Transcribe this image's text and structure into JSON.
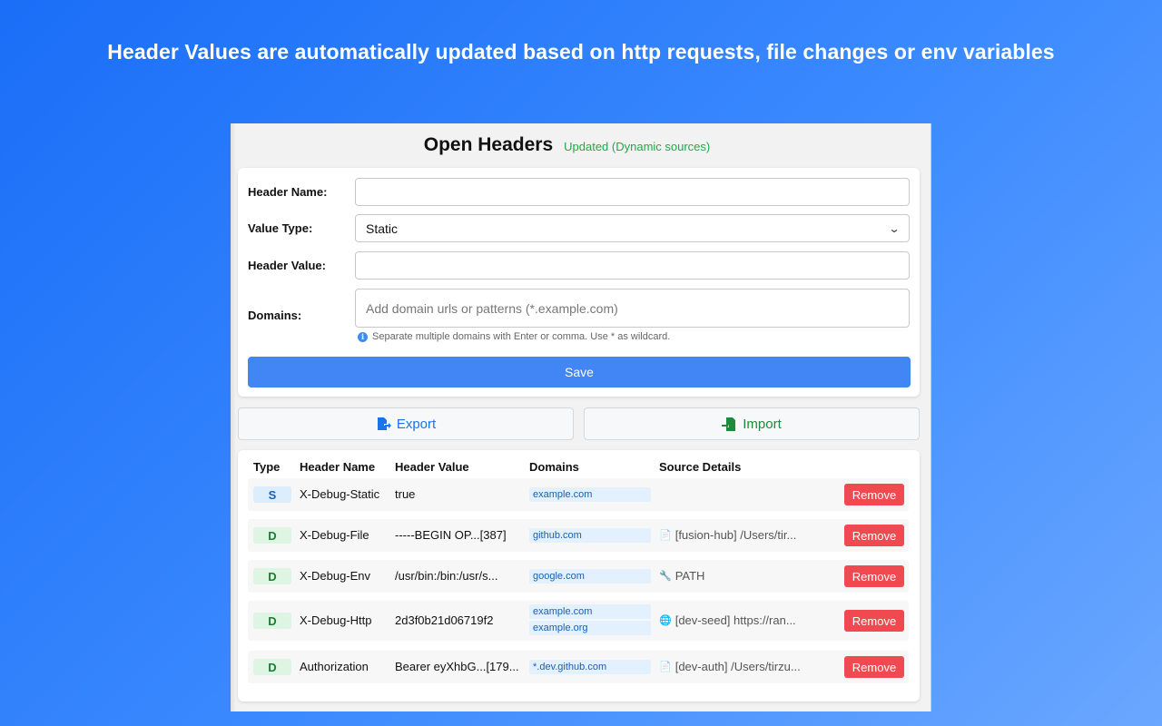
{
  "banner": {
    "text": "Header Values are automatically updated based on http requests, file changes or env variables"
  },
  "app": {
    "title": "Open Headers",
    "status": "Updated (Dynamic sources)"
  },
  "form": {
    "header_name_label": "Header Name:",
    "header_name_value": "",
    "value_type_label": "Value Type:",
    "value_type_selected": "Static",
    "header_value_label": "Header Value:",
    "header_value_value": "",
    "domains_label": "Domains:",
    "domains_placeholder": "Add domain urls or patterns (*.example.com)",
    "domains_hint": "Separate multiple domains with Enter or comma. Use * as wildcard.",
    "save_label": "Save"
  },
  "actions": {
    "export_label": "Export",
    "import_label": "Import"
  },
  "table": {
    "columns": [
      "Type",
      "Header Name",
      "Header Value",
      "Domains",
      "Source Details"
    ],
    "remove_label": "Remove",
    "rows": [
      {
        "type": "S",
        "name": "X-Debug-Static",
        "value": "true",
        "domains": [
          "example.com"
        ],
        "source_icon": "",
        "source": ""
      },
      {
        "type": "D",
        "name": "X-Debug-File",
        "value": "-----BEGIN OP...[387]",
        "domains": [
          "github.com"
        ],
        "source_icon": "file-icon",
        "source": "[fusion-hub] /Users/tir..."
      },
      {
        "type": "D",
        "name": "X-Debug-Env",
        "value": "/usr/bin:/bin:/usr/s...",
        "domains": [
          "google.com"
        ],
        "source_icon": "wrench-icon",
        "source": "PATH"
      },
      {
        "type": "D",
        "name": "X-Debug-Http",
        "value": "2d3f0b21d06719f2",
        "domains": [
          "example.com",
          "example.org"
        ],
        "source_icon": "globe-icon",
        "source": "[dev-seed] https://ran..."
      },
      {
        "type": "D",
        "name": "Authorization",
        "value": "Bearer eyXhbG...[179...",
        "domains": [
          "*.dev.github.com"
        ],
        "source_icon": "file-icon",
        "source": "[dev-auth] /Users/tirzu..."
      }
    ]
  },
  "colors": {
    "accent": "#4285f4",
    "remove": "#f0494f",
    "status_green": "#22a84a",
    "export_blue": "#1a73e8",
    "import_green": "#1f8a3b"
  }
}
